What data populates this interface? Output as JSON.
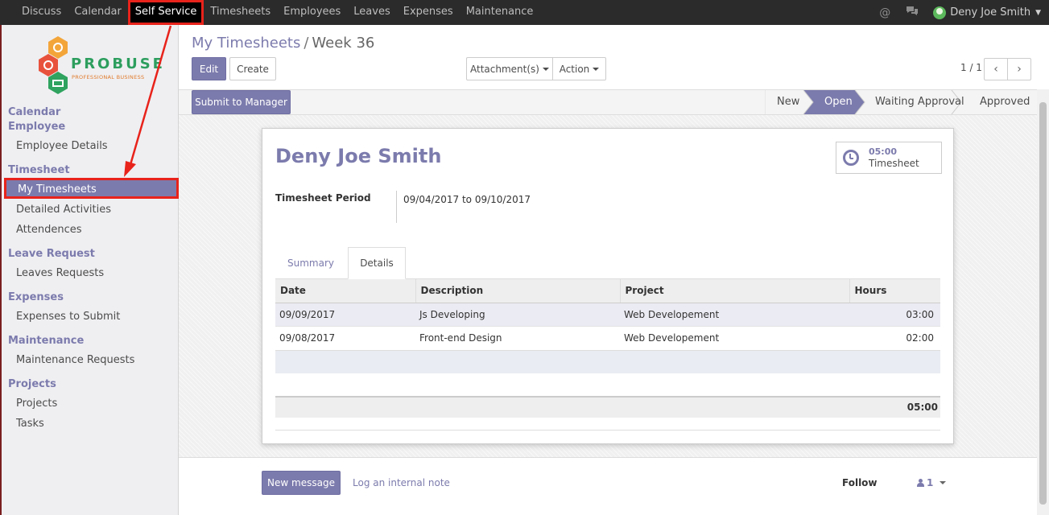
{
  "topbar": {
    "menu": [
      "Discuss",
      "Calendar",
      "Self Service",
      "Timesheets",
      "Employees",
      "Leaves",
      "Expenses",
      "Maintenance"
    ],
    "active_menu": "Self Service",
    "user_name": "Deny Joe Smith",
    "icons": [
      "at-icon",
      "chat-icon",
      "user-avatar"
    ]
  },
  "sidebar": {
    "logo": {
      "name": "PROBUSE",
      "tagline": "PROFESSIONAL BUSINESS"
    },
    "sections": [
      {
        "title": "Calendar",
        "items": []
      },
      {
        "title": "Employee",
        "items": [
          "Employee Details"
        ]
      },
      {
        "title": "Timesheet",
        "items": [
          "My Timesheets",
          "Detailed Activities",
          "Attendences"
        ]
      },
      {
        "title": "Leave Request",
        "items": [
          "Leaves Requests"
        ]
      },
      {
        "title": "Expenses",
        "items": [
          "Expenses to Submit"
        ]
      },
      {
        "title": "Maintenance",
        "items": [
          "Maintenance Requests"
        ]
      },
      {
        "title": "Projects",
        "items": [
          "Projects",
          "Tasks"
        ]
      }
    ],
    "active_item": "My Timesheets"
  },
  "breadcrumb": {
    "parent": "My Timesheets",
    "separator": "/",
    "current": "Week 36"
  },
  "toolbar": {
    "edit": "Edit",
    "create": "Create",
    "attachments": "Attachment(s)",
    "action": "Action",
    "pager": "1 / 1"
  },
  "statusbar": {
    "submit": "Submit to Manager",
    "stages": [
      "New",
      "Open",
      "Waiting Approval",
      "Approved"
    ],
    "current_stage": "Open"
  },
  "form": {
    "employee_name": "Deny Joe Smith",
    "stat_button": {
      "value": "05:00",
      "label": "Timesheet"
    },
    "period_label": "Timesheet Period",
    "period_value": "09/04/2017 to 09/10/2017",
    "tabs": [
      "Summary",
      "Details"
    ],
    "active_tab": "Details",
    "table": {
      "columns": [
        "Date",
        "Description",
        "Project",
        "Hours"
      ],
      "rows": [
        [
          "09/09/2017",
          "Js Developing",
          "Web Developement",
          "03:00"
        ],
        [
          "09/08/2017",
          "Front-end Design",
          "Web Developement",
          "02:00"
        ]
      ],
      "total": "05:00"
    }
  },
  "chatter": {
    "new_message": "New message",
    "log_note": "Log an internal note",
    "follow": "Follow",
    "followers_count": "1"
  },
  "colors": {
    "accent": "#7c7bad",
    "topbar": "#2b2b2b",
    "highlight": "#e8231b"
  }
}
